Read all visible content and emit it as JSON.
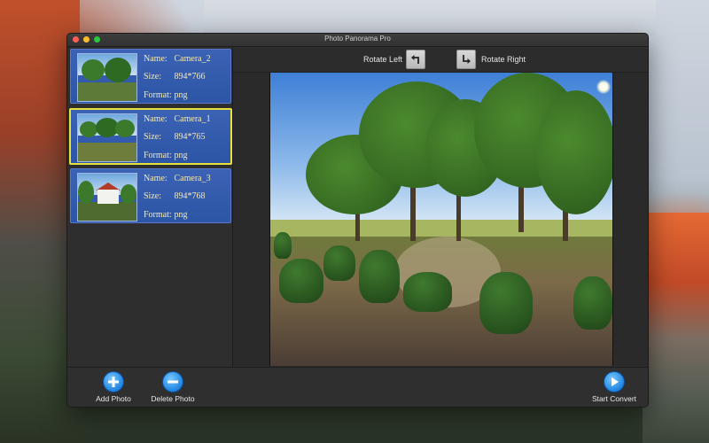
{
  "window": {
    "title": "Photo Panorama Pro"
  },
  "toolbar": {
    "rotate_left_label": "Rotate Left",
    "rotate_right_label": "Rotate Right"
  },
  "sidebar": {
    "items": [
      {
        "name_label": "Name:",
        "name": "Camera_2",
        "size_label": "Size:",
        "size": "894*766",
        "format_label": "Format:",
        "format": "png",
        "selected": false,
        "thumb": "park-scene"
      },
      {
        "name_label": "Name:",
        "name": "Camera_1",
        "size_label": "Size:",
        "size": "894*765",
        "format_label": "Format:",
        "format": "png",
        "selected": true,
        "thumb": "park-trees"
      },
      {
        "name_label": "Name:",
        "name": "Camera_3",
        "size_label": "Size:",
        "size": "894*768",
        "format_label": "Format:",
        "format": "png",
        "selected": false,
        "thumb": "white-house"
      }
    ]
  },
  "bottom": {
    "add_label": "Add Photo",
    "delete_label": "Delete Photo",
    "start_label": "Start Convert"
  },
  "colors": {
    "item_bg": "#2d55a6",
    "selected_border": "#e8e13a",
    "meta_text": "#f5e9b8",
    "action_blue": "#2a8ee6"
  },
  "icons": {
    "rotate_left": "rotate-left-icon",
    "rotate_right": "rotate-right-icon",
    "add": "plus-icon",
    "delete": "minus-icon",
    "start": "play-icon"
  }
}
